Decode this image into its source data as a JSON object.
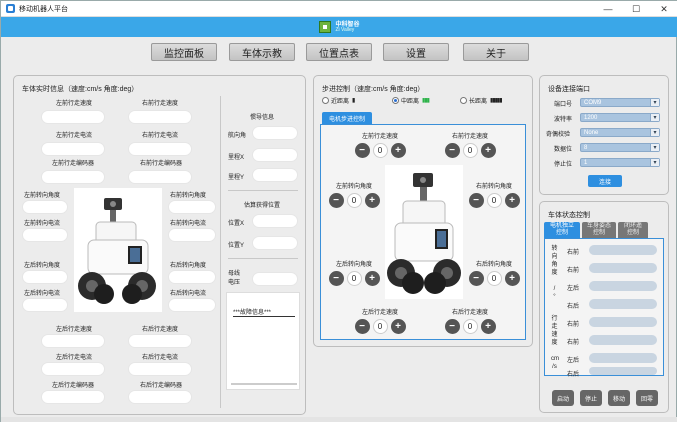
{
  "window": {
    "title": "移动机器人平台",
    "controls": {
      "minimize": "—",
      "maximize": "☐",
      "close": "✕"
    }
  },
  "banner": {
    "logo_cn": "中科智谷",
    "logo_en": "Zi Valley"
  },
  "nav": [
    "监控面板",
    "车体示教",
    "位置点表",
    "设置",
    "关于"
  ],
  "realtime": {
    "title": "车体实时信息（速度:cm/s  角度:deg）",
    "top_labels": [
      "左前行走速度",
      "右前行走速度",
      "左前行走电流",
      "右前行走电流",
      "左前行走编码器",
      "右前行走编码器"
    ],
    "mid_left": [
      "左前转向角度",
      "左前转向电流",
      "左后转向角度",
      "左后转向电流"
    ],
    "mid_right": [
      "右前转向角度",
      "右前转向电流",
      "右后转向角度",
      "右后转向电流"
    ],
    "bottom_labels": [
      "左后行走速度",
      "右后行走速度",
      "左后行走电流",
      "右后行走电流",
      "左后行走编码器",
      "右后行走编码器"
    ]
  },
  "nav_info": {
    "title": "惯导信息",
    "heading": "航向角",
    "x": "里程X",
    "y": "里程Y",
    "position_title": "估算获得位置",
    "pos_x": "位置X",
    "pos_y": "位置Y",
    "bus_voltage": "母线\n电压",
    "fault_title": "***故障信息***"
  },
  "step": {
    "title": "步进控制（速度:cm/s  角度:deg）",
    "modes": [
      {
        "label": "近距离",
        "bars": "▮",
        "bars_color": "#222",
        "selected": false
      },
      {
        "label": "中距离",
        "bars": "▮▮▮",
        "bars_color": "#2db34a",
        "selected": true
      },
      {
        "label": "长距离",
        "bars": "▮▮▮▮▮",
        "bars_color": "#222",
        "selected": false
      }
    ],
    "tab": "电机步进控制",
    "controls": [
      {
        "label": "左前行走速度",
        "value": "0"
      },
      {
        "label": "右前行走速度",
        "value": "0"
      },
      {
        "label": "左前转向角度",
        "value": "0"
      },
      {
        "label": "右前转向角度",
        "value": "0"
      },
      {
        "label": "左后转向角度",
        "value": "0"
      },
      {
        "label": "右后转向角度",
        "value": "0"
      },
      {
        "label": "左后行走速度",
        "value": "0"
      },
      {
        "label": "右后行走速度",
        "value": "0"
      }
    ],
    "minus": "−",
    "plus": "+"
  },
  "device": {
    "title": "设备连接端口",
    "rows": [
      {
        "label": "端口号",
        "value": "COM9"
      },
      {
        "label": "波特率",
        "value": "1200"
      },
      {
        "label": "奇偶校验",
        "value": "None"
      },
      {
        "label": "数据位",
        "value": "8"
      },
      {
        "label": "停止位",
        "value": "1"
      }
    ],
    "connect": "连接",
    "arrow": "▾"
  },
  "status": {
    "title": "车体状态控制",
    "tabs": [
      "电机独立\n控制",
      "车身姿态\n控制",
      "闭环遥\n控制"
    ],
    "speed_label": "转\n向\n角\n度\n\n/\n°",
    "walk_label": "行\n走\n速\n度\n\ncm\n/s",
    "rows": [
      "右前",
      "右前",
      "左后",
      "右后",
      "右前",
      "右前",
      "左后",
      "右后"
    ],
    "actions": [
      "启动",
      "停止",
      "移动",
      "回零"
    ]
  },
  "colors": {
    "accent": "#2e8fe0",
    "banner": "#3aa7e8",
    "button_dark": "#555555"
  }
}
